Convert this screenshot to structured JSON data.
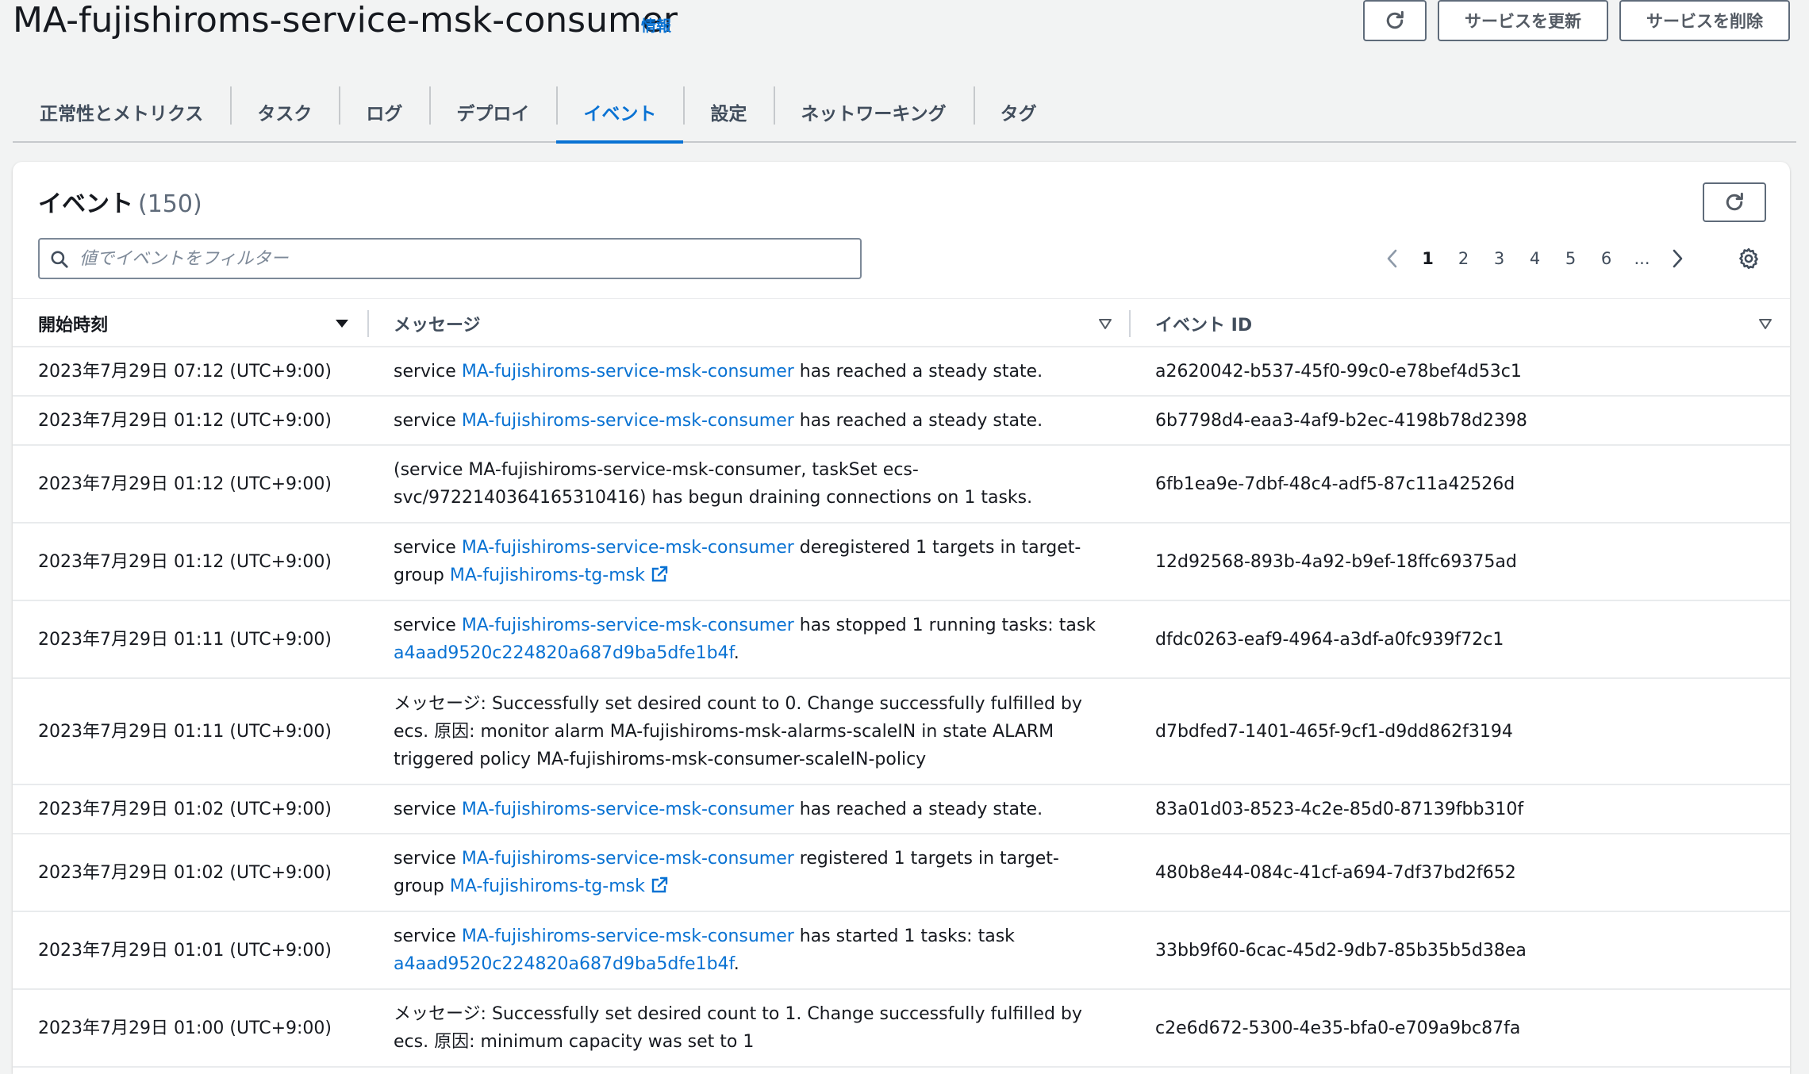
{
  "header": {
    "service_name": "MA-fujishiroms-service-msk-consumer",
    "info_label": "情報",
    "update_label": "サービスを更新",
    "delete_label": "サービスを削除"
  },
  "tabs": [
    {
      "label": "正常性とメトリクス"
    },
    {
      "label": "タスク"
    },
    {
      "label": "ログ"
    },
    {
      "label": "デプロイ"
    },
    {
      "label": "イベント",
      "active": true
    },
    {
      "label": "設定"
    },
    {
      "label": "ネットワーキング"
    },
    {
      "label": "タグ"
    }
  ],
  "events_panel": {
    "title": "イベント",
    "count": "(150)",
    "search_placeholder": "値でイベントをフィルター",
    "pagination": {
      "pages": [
        "1",
        "2",
        "3",
        "4",
        "5",
        "6"
      ],
      "ellipsis": "...",
      "current": "1"
    }
  },
  "table": {
    "columns": [
      "開始時刻",
      "メッセージ",
      "イベント ID"
    ],
    "rows": [
      {
        "time": "2023年7月29日 07:12 (UTC+9:00)",
        "message": [
          {
            "t": "service "
          },
          {
            "t": "MA-fujishiroms-service-msk-consumer",
            "link": true
          },
          {
            "t": " has reached a steady state."
          }
        ],
        "id": "a2620042-b537-45f0-99c0-e78bef4d53c1"
      },
      {
        "time": "2023年7月29日 01:12 (UTC+9:00)",
        "message": [
          {
            "t": "service "
          },
          {
            "t": "MA-fujishiroms-service-msk-consumer",
            "link": true
          },
          {
            "t": " has reached a steady state."
          }
        ],
        "id": "6b7798d4-eaa3-4af9-b2ec-4198b78d2398"
      },
      {
        "time": "2023年7月29日 01:12 (UTC+9:00)",
        "message": [
          {
            "t": "(service MA-fujishiroms-service-msk-consumer, taskSet ecs-svc/9722140364165310416) has begun draining connections on 1 tasks."
          }
        ],
        "id": "6fb1ea9e-7dbf-48c4-adf5-87c11a42526d"
      },
      {
        "time": "2023年7月29日 01:12 (UTC+9:00)",
        "message": [
          {
            "t": "service "
          },
          {
            "t": "MA-fujishiroms-service-msk-consumer",
            "link": true
          },
          {
            "t": " deregistered 1 targets in target-group "
          },
          {
            "t": "MA-fujishiroms-tg-msk",
            "link": true,
            "external": true
          }
        ],
        "id": "12d92568-893b-4a92-b9ef-18ffc69375ad"
      },
      {
        "time": "2023年7月29日 01:11 (UTC+9:00)",
        "message": [
          {
            "t": "service "
          },
          {
            "t": "MA-fujishiroms-service-msk-consumer",
            "link": true
          },
          {
            "t": " has stopped 1 running tasks: task "
          },
          {
            "t": "a4aad9520c224820a687d9ba5dfe1b4f",
            "link": true
          },
          {
            "t": "."
          }
        ],
        "id": "dfdc0263-eaf9-4964-a3df-a0fc939f72c1"
      },
      {
        "time": "2023年7月29日 01:11 (UTC+9:00)",
        "message": [
          {
            "t": "メッセージ: Successfully set desired count to 0. Change successfully fulfilled by ecs. 原因: monitor alarm MA-fujishiroms-msk-alarms-scaleIN in state ALARM triggered policy MA-fujishiroms-msk-consumer-scaleIN-policy"
          }
        ],
        "id": "d7bdfed7-1401-465f-9cf1-d9dd862f3194"
      },
      {
        "time": "2023年7月29日 01:02 (UTC+9:00)",
        "message": [
          {
            "t": "service "
          },
          {
            "t": "MA-fujishiroms-service-msk-consumer",
            "link": true
          },
          {
            "t": " has reached a steady state."
          }
        ],
        "id": "83a01d03-8523-4c2e-85d0-87139fbb310f"
      },
      {
        "time": "2023年7月29日 01:02 (UTC+9:00)",
        "message": [
          {
            "t": "service "
          },
          {
            "t": "MA-fujishiroms-service-msk-consumer",
            "link": true
          },
          {
            "t": " registered 1 targets in target-group "
          },
          {
            "t": "MA-fujishiroms-tg-msk",
            "link": true,
            "external": true
          }
        ],
        "id": "480b8e44-084c-41cf-a694-7df37bd2f652"
      },
      {
        "time": "2023年7月29日 01:01 (UTC+9:00)",
        "message": [
          {
            "t": "service "
          },
          {
            "t": "MA-fujishiroms-service-msk-consumer",
            "link": true
          },
          {
            "t": " has started 1 tasks: task "
          },
          {
            "t": "a4aad9520c224820a687d9ba5dfe1b4f",
            "link": true
          },
          {
            "t": "."
          }
        ],
        "id": "33bb9f60-6cac-45d2-9db7-85b35b5d38ea"
      },
      {
        "time": "2023年7月29日 01:00 (UTC+9:00)",
        "message": [
          {
            "t": "メッセージ: Successfully set desired count to 1. Change successfully fulfilled by ecs. 原因: minimum capacity was set to 1"
          }
        ],
        "id": "c2e6d672-5300-4e35-bfa0-e709a9bc87fa"
      }
    ]
  },
  "colors": {
    "accent": "#0972d3",
    "text": "#16191f",
    "muted": "#5f6b7a",
    "background": "#f2f3f3"
  },
  "icons": [
    "refresh-icon",
    "search-icon",
    "chevron-left-icon",
    "chevron-right-icon",
    "settings-gear-icon",
    "sort-down-icon",
    "external-link-icon"
  ]
}
